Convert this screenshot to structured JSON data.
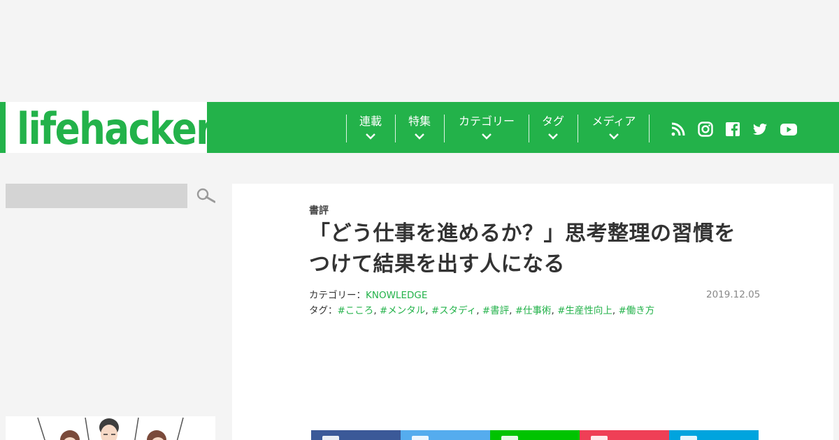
{
  "header": {
    "logo_text": "lifehacker",
    "nav": [
      {
        "label": "連載"
      },
      {
        "label": "特集"
      },
      {
        "label": "カテゴリー"
      },
      {
        "label": "タグ"
      },
      {
        "label": "メディア"
      }
    ],
    "social_icons": [
      "rss-icon",
      "instagram-icon",
      "facebook-icon",
      "twitter-icon",
      "youtube-icon"
    ]
  },
  "sidebar": {
    "search_placeholder": ""
  },
  "article": {
    "category_label": "書評",
    "title_line1": "「どう仕事を進めるか？」思考整理の習慣を",
    "title_line2": "つけて結果を出す人になる",
    "category_prefix": "カテゴリー：",
    "category_value": "KNOWLEDGE",
    "date": "2019.12.05",
    "tags_prefix": "タグ：",
    "tags": [
      "#こころ",
      "#メンタル",
      "#スタディ",
      "#書評",
      "#仕事術",
      "#生産性向上",
      "#働き方"
    ]
  },
  "share": {
    "buttons": [
      {
        "name": "facebook",
        "color": "#3b5998"
      },
      {
        "name": "twitter",
        "color": "#55acee"
      },
      {
        "name": "line",
        "color": "#00c300"
      },
      {
        "name": "pocket",
        "color": "#ef3f56"
      },
      {
        "name": "hatena",
        "color": "#00a4de"
      }
    ]
  },
  "colors": {
    "brand": "#23b24a",
    "link": "#23b24a"
  }
}
